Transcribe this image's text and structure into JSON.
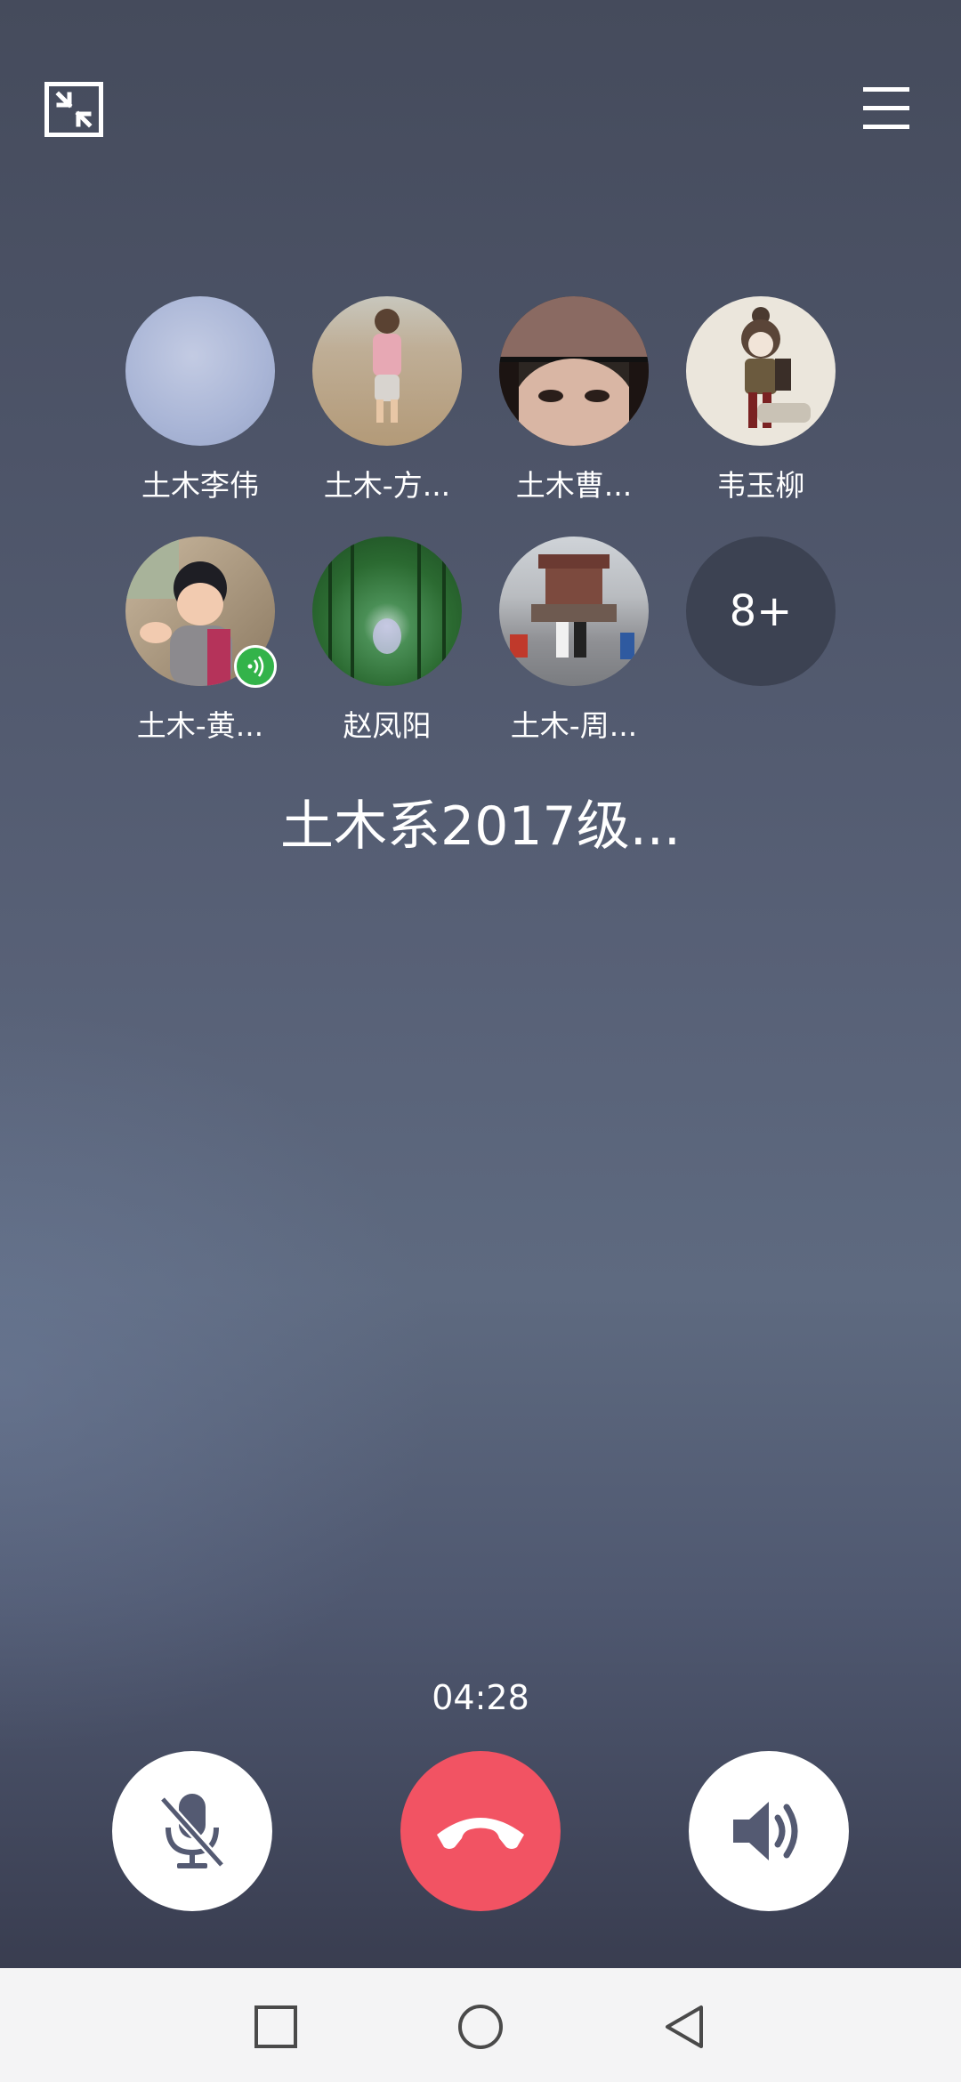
{
  "header": {
    "minimize_icon": "minimize-arrows-icon",
    "menu_icon": "hamburger-menu-icon"
  },
  "members": [
    {
      "name": "土木李伟"
    },
    {
      "name": "土木-方..."
    },
    {
      "name": "土木曹..."
    },
    {
      "name": "韦玉柳"
    },
    {
      "name": "土木-黄...",
      "speaking": true
    },
    {
      "name": "赵凤阳"
    },
    {
      "name": "土木-周..."
    }
  ],
  "more_count": "8+",
  "group_name": "土木系2017级...",
  "call_timer": "04:28",
  "controls": {
    "mute_icon": "microphone-muted-icon",
    "hangup_icon": "phone-hangup-icon",
    "speaker_icon": "speaker-icon",
    "hangup_color": "#f25363"
  },
  "navbar": {
    "recent_icon": "square-icon",
    "home_icon": "circle-icon",
    "back_icon": "triangle-back-icon"
  }
}
